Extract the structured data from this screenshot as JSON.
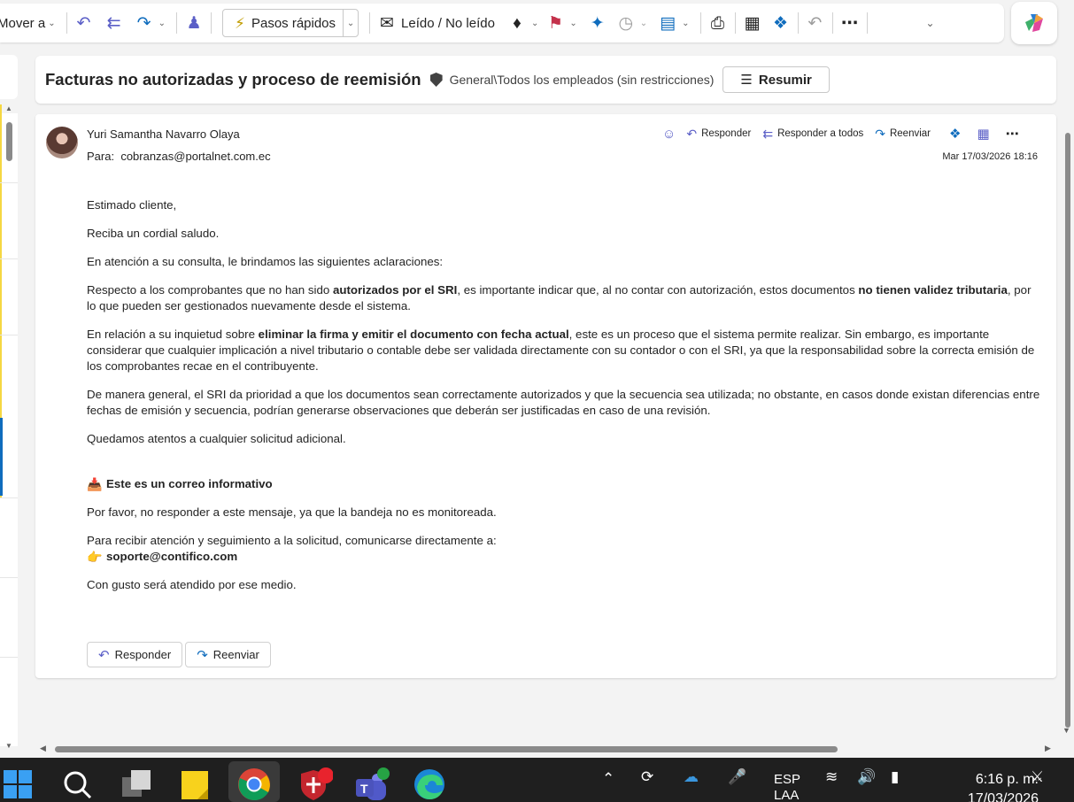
{
  "ribbon": {
    "move_label": "Mover a",
    "quick_steps_label": "Pasos rápidos",
    "read_unread_label": "Leído / No leído"
  },
  "subject": {
    "title": "Facturas no autorizadas y proceso de reemisión",
    "sensitivity_label": "General\\Todos los empleados (sin restricciones)",
    "summarize_label": "Resumir"
  },
  "message": {
    "sender": "Yuri Samantha Navarro Olaya",
    "to_prefix": "Para:",
    "to_address": "cobranzas@portalnet.com.ec",
    "date": "Mar 17/03/2026 18:16",
    "actions": {
      "reply": "Responder",
      "reply_all": "Responder a todos",
      "forward": "Reenviar"
    },
    "body": {
      "greeting": "Estimado cliente,",
      "salute": "Reciba un cordial saludo.",
      "intro": "En atención a su consulta, le brindamos las siguientes aclaraciones:",
      "p1_a": "Respecto a los comprobantes que no han sido ",
      "p1_b": "autorizados por el SRI",
      "p1_c": ", es importante indicar que, al no contar con autorización, estos documentos ",
      "p1_d": "no tienen validez tributaria",
      "p1_e": ", por lo que pueden ser gestionados nuevamente desde el sistema.",
      "p2_a": "En relación a su inquietud sobre ",
      "p2_b": "eliminar la firma y emitir el documento con fecha actual",
      "p2_c": ", este es un proceso que el sistema permite realizar. Sin embargo, es importante considerar que cualquier implicación a nivel tributario o contable debe ser validada directamente con su contador o con el SRI, ya que la responsabilidad sobre la correcta emisión de los comprobantes recae en el contribuyente.",
      "p3": "De manera general, el SRI da prioridad a que los documentos sean correctamente autorizados y que la secuencia sea utilizada; no obstante, en casos donde existan diferencias entre fechas de emisión y secuencia, podrían generarse observaciones que deberán ser justificadas en caso de una revisión.",
      "p4": "Quedamos atentos a cualquier solicitud adicional.",
      "info_title": "Este es un correo informativo",
      "info_text": "Por favor, no responder a este mensaje, ya que la bandeja no es monitoreada.",
      "contact_text": "Para recibir atención y seguimiento a la solicitud, comunicarse directamente a:",
      "support_email": "soporte@contifico.com",
      "closing": "Con gusto será atendido por ese medio."
    },
    "buttons": {
      "reply": "Responder",
      "forward": "Reenviar"
    }
  },
  "taskbar": {
    "lang_1": "ESP",
    "lang_2": "LAA",
    "time": "6:16 p. m.",
    "date": "17/03/2026"
  },
  "colors": {
    "accent": "#0f6cbd",
    "purple": "#5b5fc7",
    "flag_red": "#c4314b",
    "label_yellow": "#f5d742"
  }
}
